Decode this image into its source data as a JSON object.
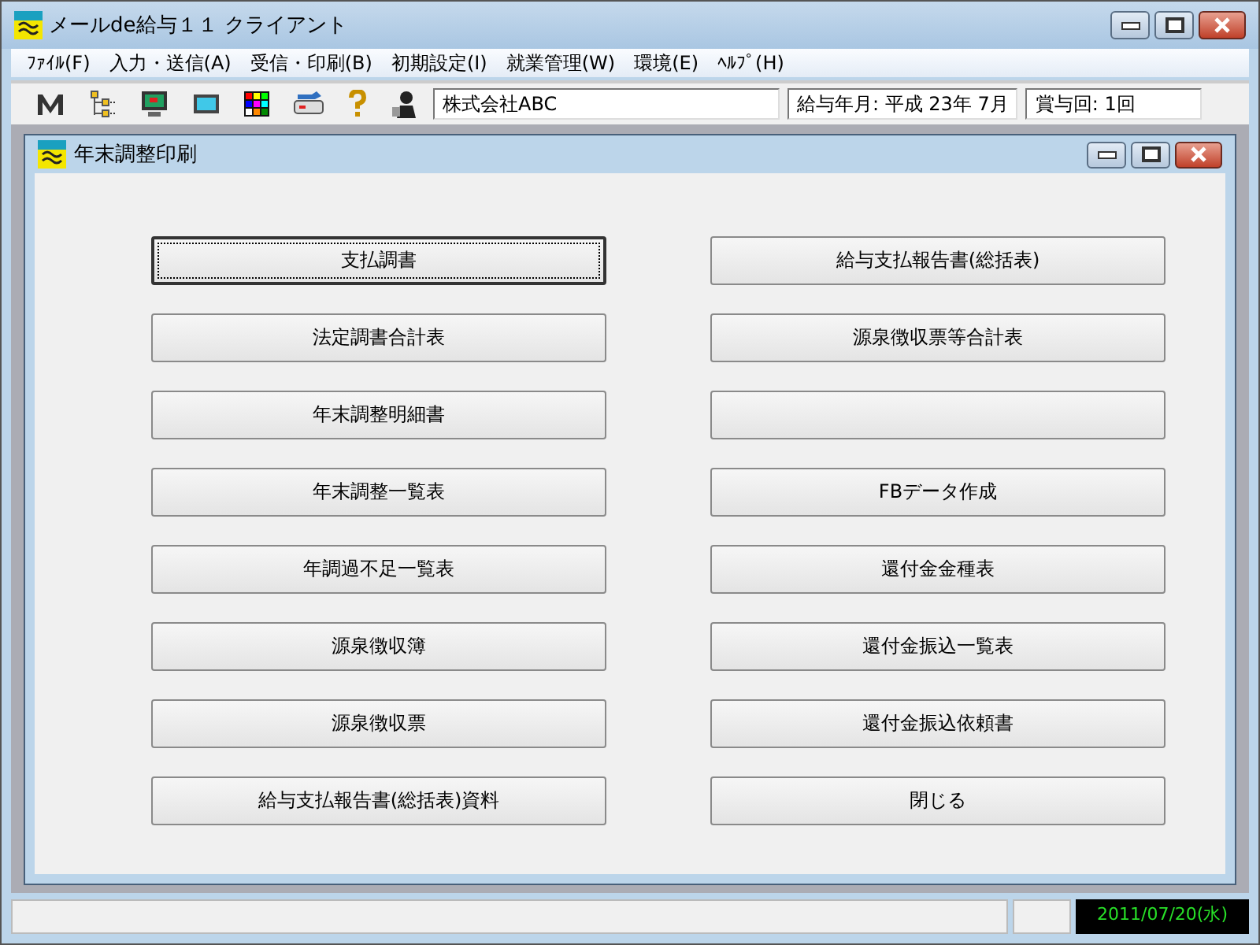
{
  "window": {
    "title": "メールde給与１１ クライアント"
  },
  "menu": [
    "ﾌｧｲﾙ(F)",
    "入力・送信(A)",
    "受信・印刷(B)",
    "初期設定(I)",
    "就業管理(W)",
    "環境(E)",
    "ﾍﾙﾌﾟ(H)"
  ],
  "toolbar": {
    "company": "株式会社ABC",
    "pay_month": "給与年月: 平成 23年  7月",
    "bonus": "賞与回: 1回"
  },
  "child_window": {
    "title": "年末調整印刷"
  },
  "buttons_left": [
    {
      "label": "支払調書",
      "focused": true
    },
    {
      "label": "法定調書合計表",
      "focused": false
    },
    {
      "label": "年末調整明細書",
      "focused": false
    },
    {
      "label": "年末調整一覧表",
      "focused": false
    },
    {
      "label": "年調過不足一覧表",
      "focused": false
    },
    {
      "label": "源泉徴収簿",
      "focused": false
    },
    {
      "label": "源泉徴収票",
      "focused": false
    },
    {
      "label": "給与支払報告書(総括表)資料",
      "focused": false
    }
  ],
  "buttons_right": [
    {
      "label": "給与支払報告書(総括表)",
      "focused": false
    },
    {
      "label": "源泉徴収票等合計表",
      "focused": false
    },
    {
      "focused": false
    },
    {
      "label": "FBデータ作成",
      "focused": false
    },
    {
      "label": "還付金金種表",
      "focused": false
    },
    {
      "label": "還付金振込一覧表",
      "focused": false
    },
    {
      "label": "還付金振込依頼書",
      "focused": false
    },
    {
      "label": "閉じる",
      "focused": false
    }
  ],
  "status_bar": {
    "date": "2011/07/20(水)"
  }
}
